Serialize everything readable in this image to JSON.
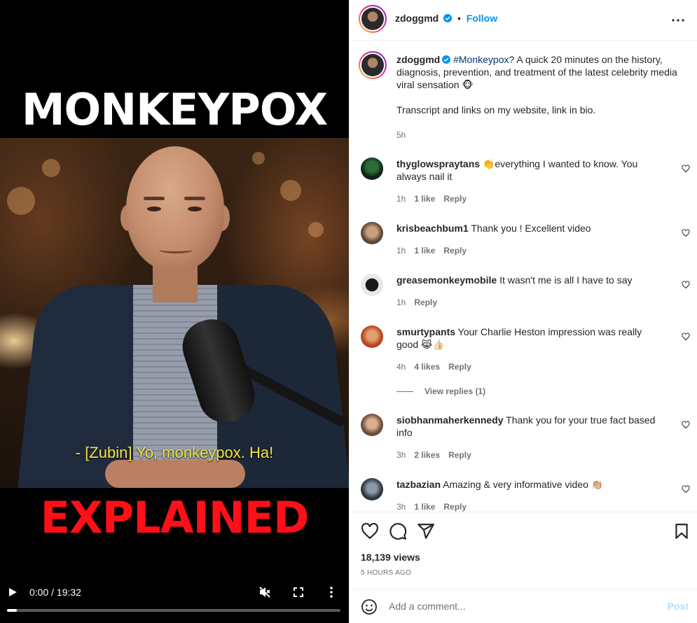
{
  "video": {
    "title_top": "MONKEYPOX",
    "title_bottom": "EXPLAINED",
    "caption": "- [Zubin] Yo, monkeypox. Ha!",
    "time": "0:00 / 19:32",
    "progress": 0.03
  },
  "header": {
    "username": "zdoggmd",
    "separator": "•",
    "follow_label": "Follow"
  },
  "caption_post": {
    "username": "zdoggmd",
    "hashtag": "#Monkeypox",
    "text": "? A quick 20 minutes on the history, diagnosis, prevention, and treatment of the latest celebrity media viral sensation 🐵",
    "text2": "Transcript and links on my website, link in bio.",
    "time": "5h"
  },
  "comments": [
    {
      "username": "thyglowspraytans",
      "text": "👏everything I wanted to know. You always nail it",
      "time": "1h",
      "likes": "1 like",
      "reply": "Reply"
    },
    {
      "username": "krisbeachbum1",
      "text": "Thank you ! Excellent video",
      "time": "1h",
      "likes": "1 like",
      "reply": "Reply"
    },
    {
      "username": "greasemonkeymobile",
      "text": "It wasn't me is all I have to say",
      "time": "1h",
      "likes": "",
      "reply": "Reply"
    },
    {
      "username": "smurtypants",
      "text": "Your Charlie Heston impression was really good 😹👍🏻",
      "time": "4h",
      "likes": "4 likes",
      "reply": "Reply"
    },
    {
      "username": "siobhanmaherkennedy",
      "text": "Thank you for your true fact based info",
      "time": "3h",
      "likes": "2 likes",
      "reply": "Reply"
    },
    {
      "username": "tazbazian",
      "text": "Amazing & very informative video 👏🏼",
      "time": "3h",
      "likes": "1 like",
      "reply": "Reply"
    }
  ],
  "view_replies": "View replies (1)",
  "stats": {
    "views": "18,139 views",
    "ago": "5 HOURS AGO"
  },
  "comment_box": {
    "placeholder": "Add a comment...",
    "post_label": "Post"
  },
  "colors": {
    "accent": "#0095f6",
    "hashtag": "#00376b",
    "muted": "#737373",
    "post_disabled": "#b3dbff",
    "title_red": "#ff1019",
    "caption_yellow": "#f3e34a"
  },
  "icons": [
    "play-icon",
    "mute-icon",
    "fullscreen-icon",
    "video-more-icon",
    "verified-icon",
    "more-icon",
    "heart-icon",
    "comment-icon",
    "share-icon",
    "bookmark-icon",
    "emoji-icon"
  ]
}
